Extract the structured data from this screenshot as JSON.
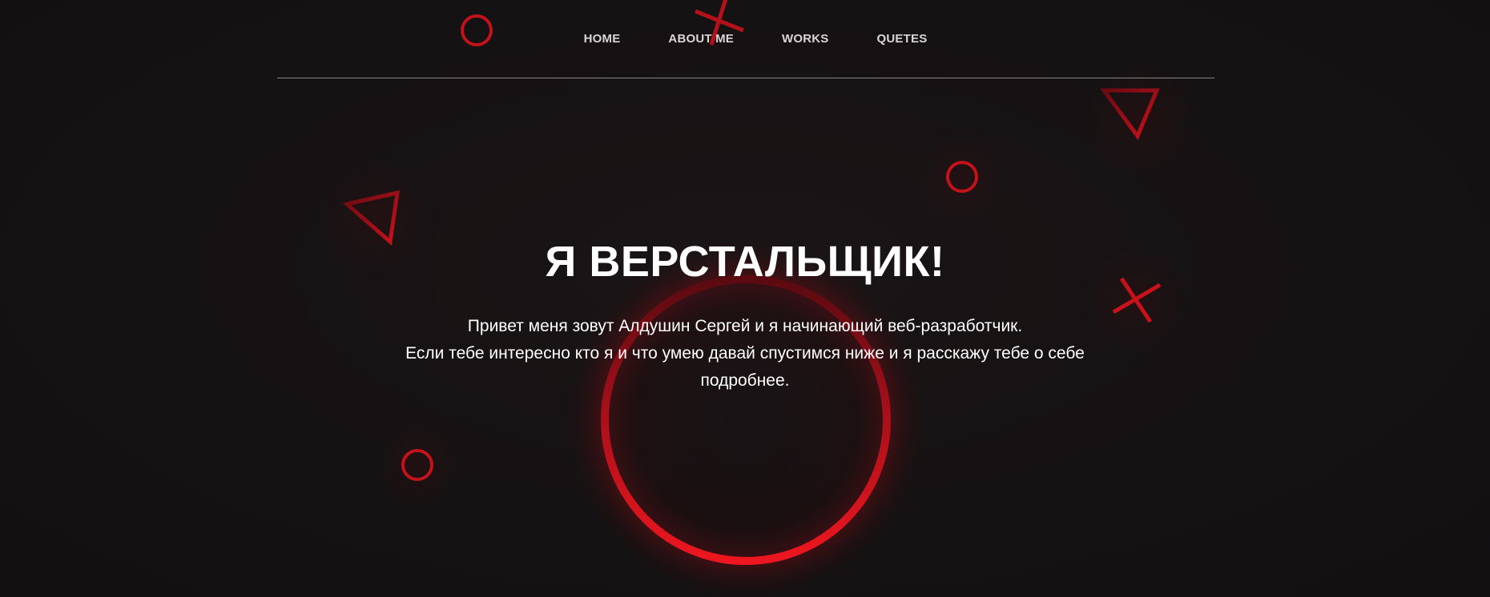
{
  "nav": {
    "items": [
      {
        "label": "HOME"
      },
      {
        "label": "ABOUT ME"
      },
      {
        "label": "WORKS"
      },
      {
        "label": "QUETES"
      }
    ]
  },
  "hero": {
    "title": "Я ВЕРСТАЛЬЩИК!",
    "line1": "Привет меня зовут Алдушин Сергей и я начинающий веб-разработчик.",
    "line2": "Если тебе интересно кто я и что умею давай спустимся ниже и я расскажу тебе о себе подробнее."
  },
  "colors": {
    "accent": "#e3131b",
    "background": "#151213",
    "text": "#ffffff",
    "nav_text": "#d9d6d7",
    "divider": "#8a8788"
  }
}
